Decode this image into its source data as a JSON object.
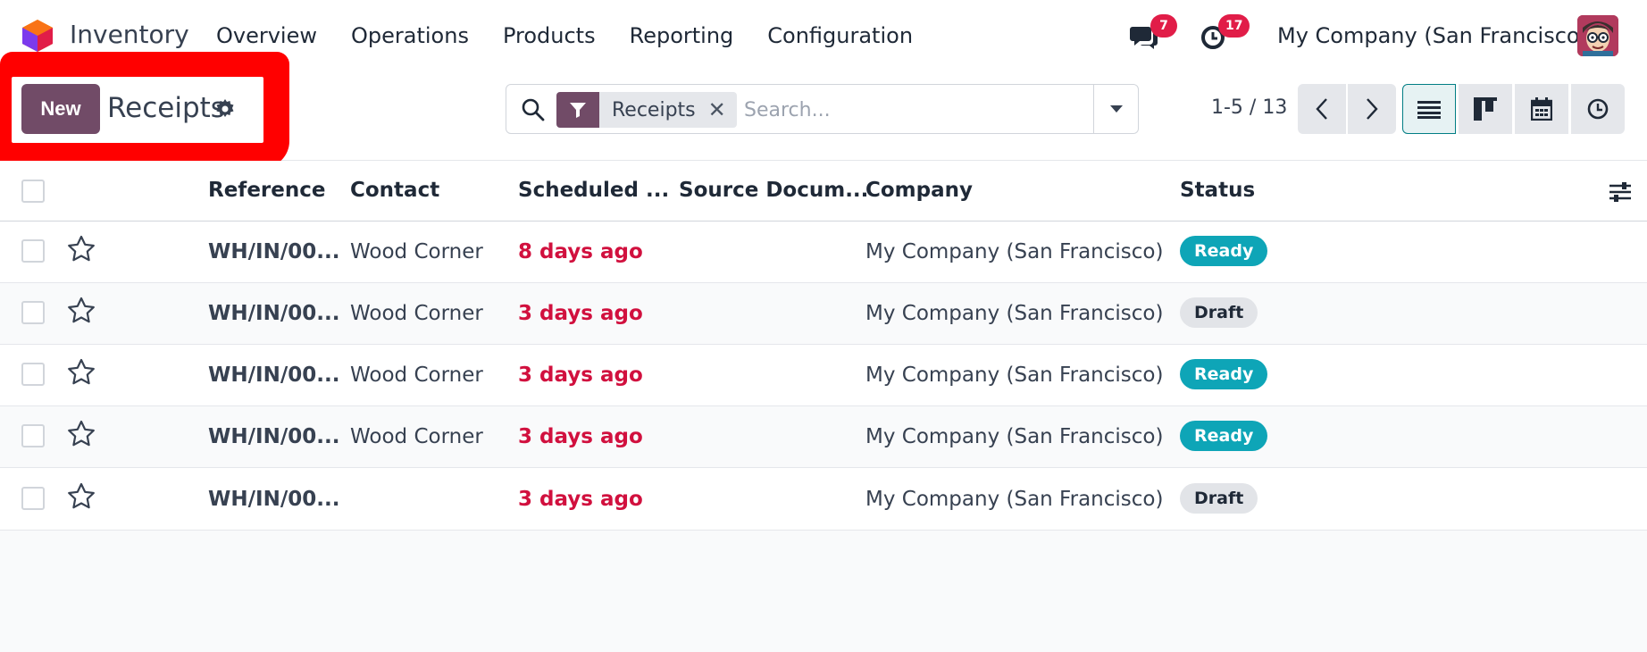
{
  "navbar": {
    "app_name": "Inventory",
    "menu": [
      "Overview",
      "Operations",
      "Products",
      "Reporting",
      "Configuration"
    ],
    "messages_count": "7",
    "activities_count": "17",
    "company": "My Company (San Francisco)"
  },
  "control": {
    "new_label": "New",
    "title": "Receipts",
    "facet_label": "Receipts",
    "facet_close": "✕",
    "search_placeholder": "Search...",
    "pager": "1-5 / 13"
  },
  "list": {
    "columns": [
      "Reference",
      "Contact",
      "Scheduled ...",
      "Source Docum...",
      "Company",
      "Status"
    ],
    "rows": [
      {
        "reference": "WH/IN/00...",
        "contact": "Wood Corner",
        "scheduled": "8 days ago",
        "source": "",
        "company": "My Company (San Francisco)",
        "status": "Ready"
      },
      {
        "reference": "WH/IN/00...",
        "contact": "Wood Corner",
        "scheduled": "3 days ago",
        "source": "",
        "company": "My Company (San Francisco)",
        "status": "Draft"
      },
      {
        "reference": "WH/IN/00...",
        "contact": "Wood Corner",
        "scheduled": "3 days ago",
        "source": "",
        "company": "My Company (San Francisco)",
        "status": "Ready"
      },
      {
        "reference": "WH/IN/00...",
        "contact": "Wood Corner",
        "scheduled": "3 days ago",
        "source": "",
        "company": "My Company (San Francisco)",
        "status": "Ready"
      },
      {
        "reference": "WH/IN/00...",
        "contact": "",
        "scheduled": "3 days ago",
        "source": "",
        "company": "My Company (San Francisco)",
        "status": "Draft"
      }
    ]
  },
  "colors": {
    "brand": "#714b67",
    "highlight": "#ff0000",
    "late": "#d1103e",
    "ready": "#0ea5b7",
    "badge_alert": "#e11d48"
  },
  "icons": [
    "app-logo-icon",
    "chat-icon",
    "clock-icon",
    "gear-icon",
    "search-icon",
    "filter-icon",
    "caret-down-icon",
    "chevron-left-icon",
    "chevron-right-icon",
    "list-view-icon",
    "kanban-view-icon",
    "calendar-view-icon",
    "activity-view-icon",
    "star-icon",
    "optional-columns-icon"
  ]
}
